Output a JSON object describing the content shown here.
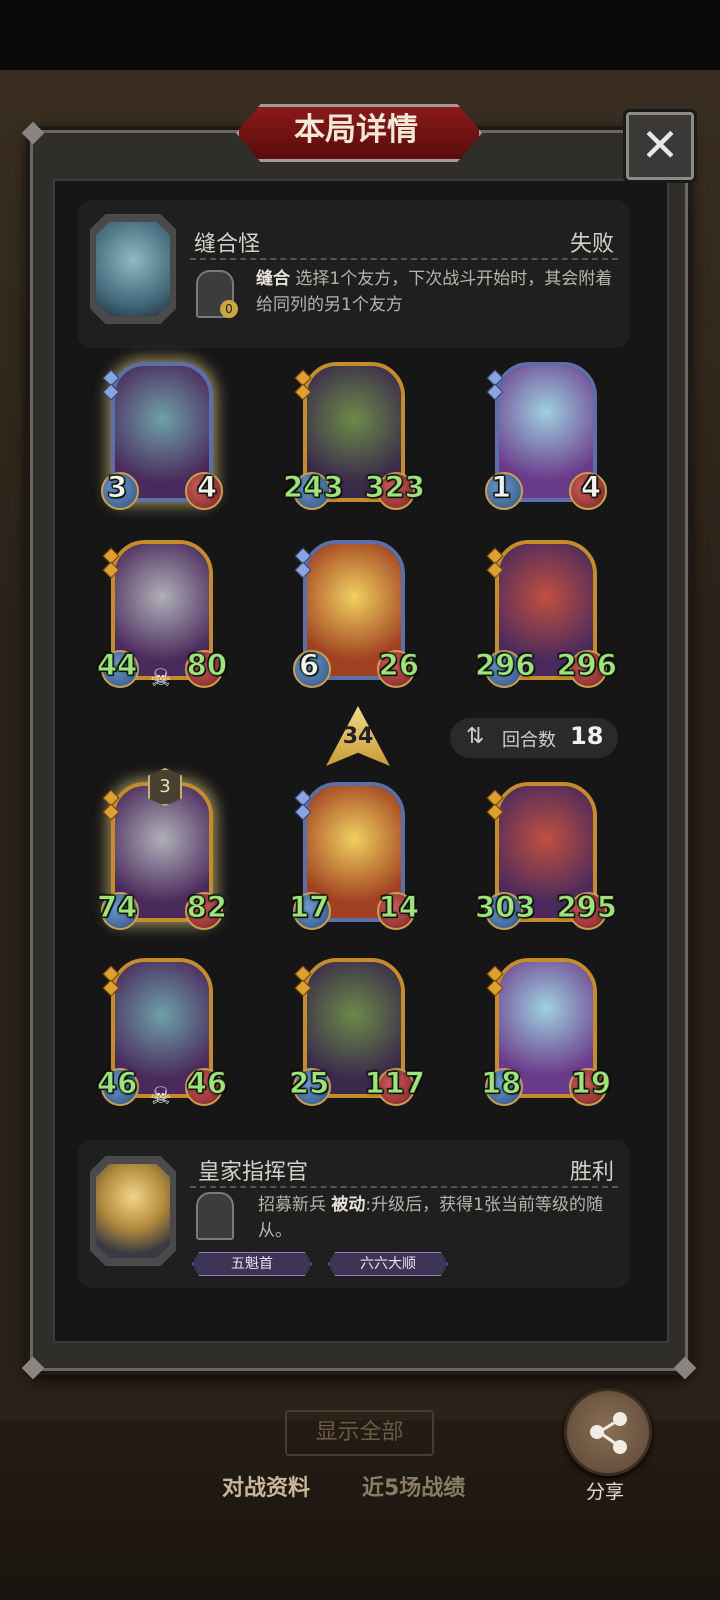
{
  "title": "本局详情",
  "close_icon": "close-icon",
  "opponent": {
    "name": "缝合怪",
    "result": "失败",
    "power_name": "缝合",
    "power_desc": "选择1个友方，下次战斗开始时，其会附着给同列的另1个友方",
    "power_cost": "0"
  },
  "player": {
    "name": "皇家指挥官",
    "result": "胜利",
    "power_name": "招募新兵",
    "power_type": "被动",
    "power_desc": ":升级后，获得1张当前等级的随从。",
    "badges": [
      "五魁首",
      "六六大顺"
    ]
  },
  "opponent_board": [
    {
      "attack": "3",
      "health": "4",
      "tier_color": "blue",
      "glow": true
    },
    {
      "attack": "243",
      "health": "323",
      "tier_color": "gold",
      "glow": false
    },
    {
      "attack": "1",
      "health": "4",
      "tier_color": "blue",
      "glow": false
    },
    {
      "attack": "44",
      "health": "80",
      "tier_color": "gold",
      "glow": false,
      "skull": true
    },
    {
      "attack": "6",
      "health": "26",
      "tier_color": "blue",
      "glow": false
    },
    {
      "attack": "296",
      "health": "296",
      "tier_color": "gold",
      "glow": false
    }
  ],
  "player_board": [
    {
      "attack": "74",
      "health": "82",
      "tier_color": "gold",
      "glow": true,
      "level": "3"
    },
    {
      "attack": "17",
      "health": "14",
      "tier_color": "blue",
      "glow": false
    },
    {
      "attack": "303",
      "health": "295",
      "tier_color": "gold",
      "glow": false
    },
    {
      "attack": "46",
      "health": "46",
      "tier_color": "gold",
      "glow": false,
      "skull": true
    },
    {
      "attack": "25",
      "health": "117",
      "tier_color": "gold",
      "glow": false
    },
    {
      "attack": "18",
      "health": "19",
      "tier_color": "gold",
      "glow": false
    }
  ],
  "damage": "34",
  "rounds": {
    "label": "回合数",
    "value": "18"
  },
  "bottom": {
    "hidden_button": "显示全部",
    "tab_active": "对战资料",
    "tab_inactive": "近5场战绩",
    "share_label": "分享"
  }
}
